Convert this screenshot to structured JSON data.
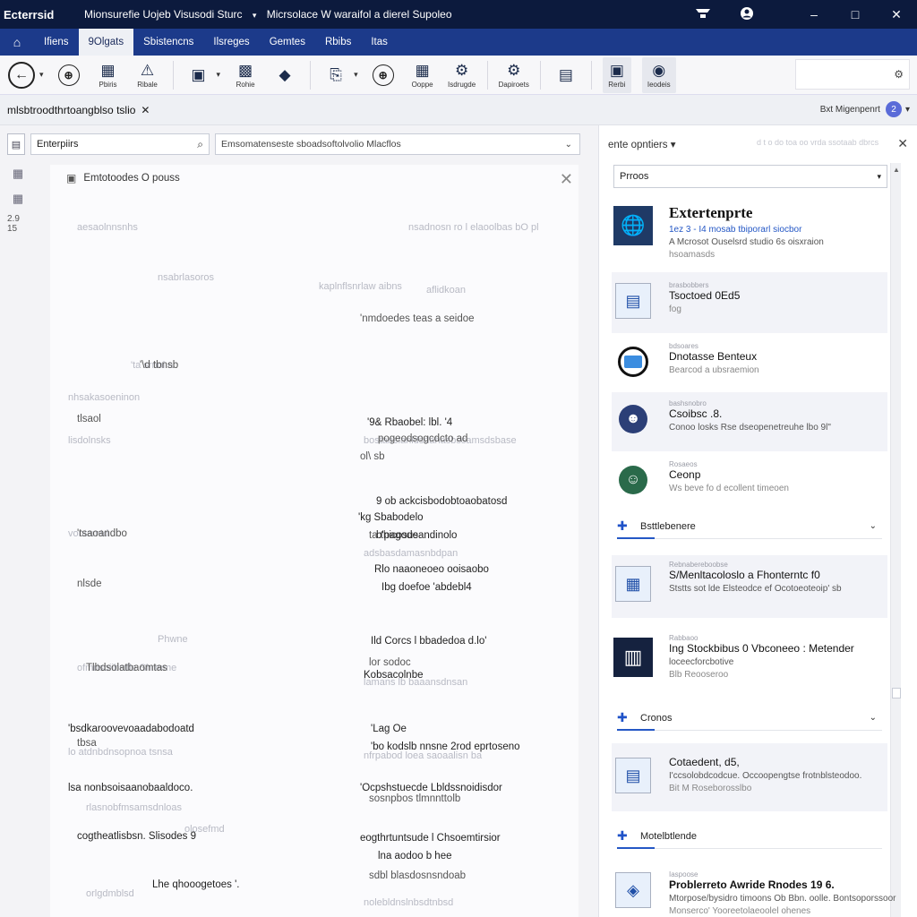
{
  "titlebar": {
    "logo_text": "Ecterrsid",
    "title": "Mionsurefie Uojeb Visusodi Sturc",
    "sep": "▾",
    "subtitle": "Micrsolace W waraifol a dierel Supoleo",
    "icons": [
      "bell-icon",
      "user-icon"
    ],
    "controls": {
      "minimize": "–",
      "maximize": "□",
      "close": "✕"
    }
  },
  "menu": {
    "home_icon": "⌂",
    "items": [
      "Ifiens",
      "9Olgats",
      "Sbistencns",
      "Ilsreges",
      "Gemtes",
      "Rbibs",
      "Itas"
    ],
    "active_index": 1
  },
  "ribbon": {
    "buttons": [
      {
        "icon": "←",
        "label": ""
      },
      {
        "icon": "⊕",
        "label": ""
      },
      {
        "icon": "▦",
        "label": "Pbiris"
      },
      {
        "icon": "⚠",
        "label": "Ribale"
      },
      {
        "icon": "▣",
        "label": ""
      },
      {
        "icon": "▩",
        "label": "Rohie"
      },
      {
        "icon": "◆",
        "label": ""
      },
      {
        "icon": "⎘",
        "label": ""
      },
      {
        "icon": "⊕",
        "label": ""
      },
      {
        "icon": "▦",
        "label": "Ooppe"
      },
      {
        "icon": "⚙",
        "label": "Isdrugde"
      },
      {
        "icon": "⚙",
        "label": "Dapiroets"
      },
      {
        "icon": "▤",
        "label": ""
      },
      {
        "icon": "▣",
        "label": "Rerbi"
      },
      {
        "icon": "◉",
        "label": "Ieodeis"
      }
    ],
    "search_icon": "⚙"
  },
  "crumbrow": {
    "breadcrumb": "mlsbtroodthrtoangblso tslio",
    "close": "✕",
    "account_label": "Bxt Migenpenrt",
    "badge": "2",
    "chevron": "▾"
  },
  "search": {
    "value": "Enterpiirs",
    "icon": "⌕",
    "path": "Emsomatenseste sboadsoftolvolio Mlacflos",
    "chevron": "⌄"
  },
  "sidebar": {
    "icons": [
      "▦",
      "▦"
    ],
    "text": "2.9 15"
  },
  "panel": {
    "title": "Emtotoodes O pouss",
    "close": "✕",
    "faded": [
      "aesaolnnsnhs",
      "nsadnosn ro l elaoolbas bO pl",
      "nsabrlasoros",
      "kaplnflsnrlaw aibns",
      "aflidkoan",
      "'ta srnol a",
      "lisdolnsks",
      "vontamtd",
      "Phwne",
      "ofmrlsoiibstlle Shrmme",
      "lo atdnbdnsopnoa tsnsa",
      "rlasnobfmsamsdnloas",
      "bostanslanldsdahasbssamsdsbase",
      "adsbasdamasnbdpan",
      "lamans lb baaansdnsan",
      "nfrpabod loea saoaalisn ba",
      "orlgdmblsd",
      "nolebldnslnbsdtnbsd",
      "nhsakasoeninon",
      "olosefmd"
    ],
    "mid": [
      "'nmdoedes teas a seidoe",
      "'\\d tbnsb",
      "tlsaol",
      "'tsaoandbo",
      "pogeodsogcdcto ad",
      "ol\\ sb",
      "nlsde",
      "Tlbdsolatbaomtas",
      "ta thicosus",
      "lor sodoc",
      "sosnpbos tlmnnttolb",
      "tbsa",
      "sdbl blasdosnsndoab"
    ],
    "strong": [
      "'9& Rbaobel: lbl. '4",
      "'kg Sbabodelo",
      "9 ob ackcisbodobtoaobatosd",
      "b'pagodeandinolo",
      "Ibg doefoe 'abdebl4",
      "Rlo naaoneoeo ooisaobo",
      "Kobsacolnbe",
      "Ild Corcs l bbadedoa d.lo'",
      "'bsdkaroovevoaadabodoatd",
      "'Lag Oe",
      "'bo kodslb nnsne 2rod eprtoseno",
      "lsa nonbsoisaanobaaldoco.",
      "'Ocpshstuecde Lbldssnoidisdor",
      "lna aodoo b hee",
      "cogtheatlisbsn. Slisodes 9",
      "eogthrtuntsude l Chsoemtirsior",
      "Lhe qhooogetoes '."
    ]
  },
  "right_pane": {
    "header": "ente opntiers",
    "header_chev": "▾",
    "faded_right": "d t o do toa oo vrda ssotaab dbrcs",
    "close": "✕",
    "select_value": "Prroos",
    "select_chev": "▾",
    "cards": [
      {
        "tiny": "",
        "title": "Extertenprte",
        "sub1": "1ez 3 - I4  mosab tbiporarl siocbor",
        "sub2": "A Mcrosot Ouselsrd studio 6s oisxraion",
        "sub3": "hsoamasds"
      },
      {
        "tiny": "brasbobbers",
        "title": "Tsoctoed 0Ed5",
        "sub1": "fog"
      },
      {
        "tiny": "bdsoares",
        "title": "Dnotasse Benteux",
        "sub1": "Bearcod a ubsraemion"
      },
      {
        "tiny": "bashsnobro",
        "title": "Csoibsc .8.",
        "sub1": "Conoo losks Rse dseopenetreuhe lbo 9l\""
      },
      {
        "tiny": "Rosaeos",
        "title": "Ceonp",
        "sub1": "Ws beve fo d ecollent timeoen"
      }
    ],
    "group1": {
      "label": "Bsttlebenere",
      "chev": "⌄"
    },
    "cards2": [
      {
        "tiny": "Rebnabereboobse",
        "title": "S/Menltacoloslo a Fhonterntc f0",
        "sub1": "Ststts sot lde Elsteodce ef Ocotoeoteoip' sb"
      },
      {
        "tiny": "Rabbaoo",
        "title": "Ing Stockbibus 0 Vbconeeo : Metender",
        "sub1": "loceecforcbotive",
        "sub2": "Blb Reooseroo"
      }
    ],
    "group2": {
      "label": "Cronos",
      "chev": "⌄"
    },
    "cards3": [
      {
        "tiny": "",
        "title": "Cotaedent, d5,",
        "sub1": "I'ccsolobdcodcue. Occoopengtse frotnblsteodoo.",
        "sub2": "Bit M Roseborosslbo"
      }
    ],
    "group3": {
      "label": "Motelbtlende"
    },
    "cards4": [
      {
        "tiny": "Iaspoose",
        "title": "Problerreto Awride Rnodes 19 6.",
        "sub1": "Mtorpose/bysidro timoons Ob Bbn. oolle. Bontsoporssoor",
        "sub2": "Monserco' Yooreetolaeoolel ohenes"
      }
    ]
  }
}
